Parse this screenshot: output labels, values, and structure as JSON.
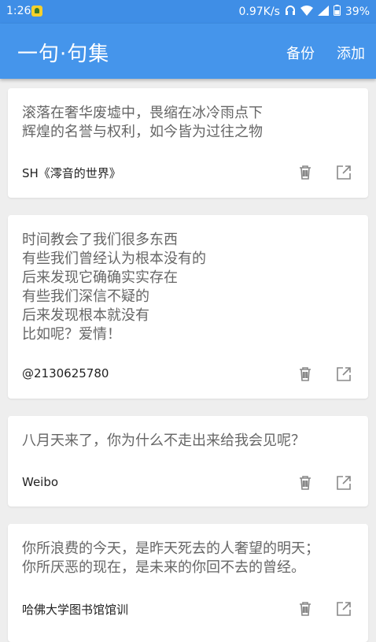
{
  "status_bar": {
    "time": "1:26",
    "network_speed": "0.97K/s",
    "battery": "39%"
  },
  "app_bar": {
    "title": "一句·句集",
    "backup_label": "备份",
    "add_label": "添加"
  },
  "colors": {
    "primary": "#4595eb",
    "status": "#3f8ee6",
    "background": "#eeeeee",
    "quote_text": "#666666",
    "icon": "#888888"
  },
  "cards": [
    {
      "quote": "滚落在奢华废墟中，畏缩在冰冷雨点下\n辉煌的名誉与权利，如今皆为过往之物",
      "source": "SH《澪音的世界》",
      "delete_icon": "trash-icon",
      "share_icon": "share-icon"
    },
    {
      "quote": "时间教会了我们很多东西\n有些我们曾经认为根本没有的\n后来发现它确确实实存在\n有些我们深信不疑的\n后来发现根本就没有\n比如呢？爱情！",
      "source": "@2130625780",
      "delete_icon": "trash-icon",
      "share_icon": "share-icon"
    },
    {
      "quote": "八月天来了，你为什么不走出来给我会见呢？",
      "source": "Weibo",
      "delete_icon": "trash-icon",
      "share_icon": "share-icon"
    },
    {
      "quote": "你所浪费的今天，是昨天死去的人奢望的明天；\n你所厌恶的现在，是未来的你回不去的曾经。",
      "source": "哈佛大学图书馆馆训",
      "delete_icon": "trash-icon",
      "share_icon": "share-icon"
    }
  ]
}
